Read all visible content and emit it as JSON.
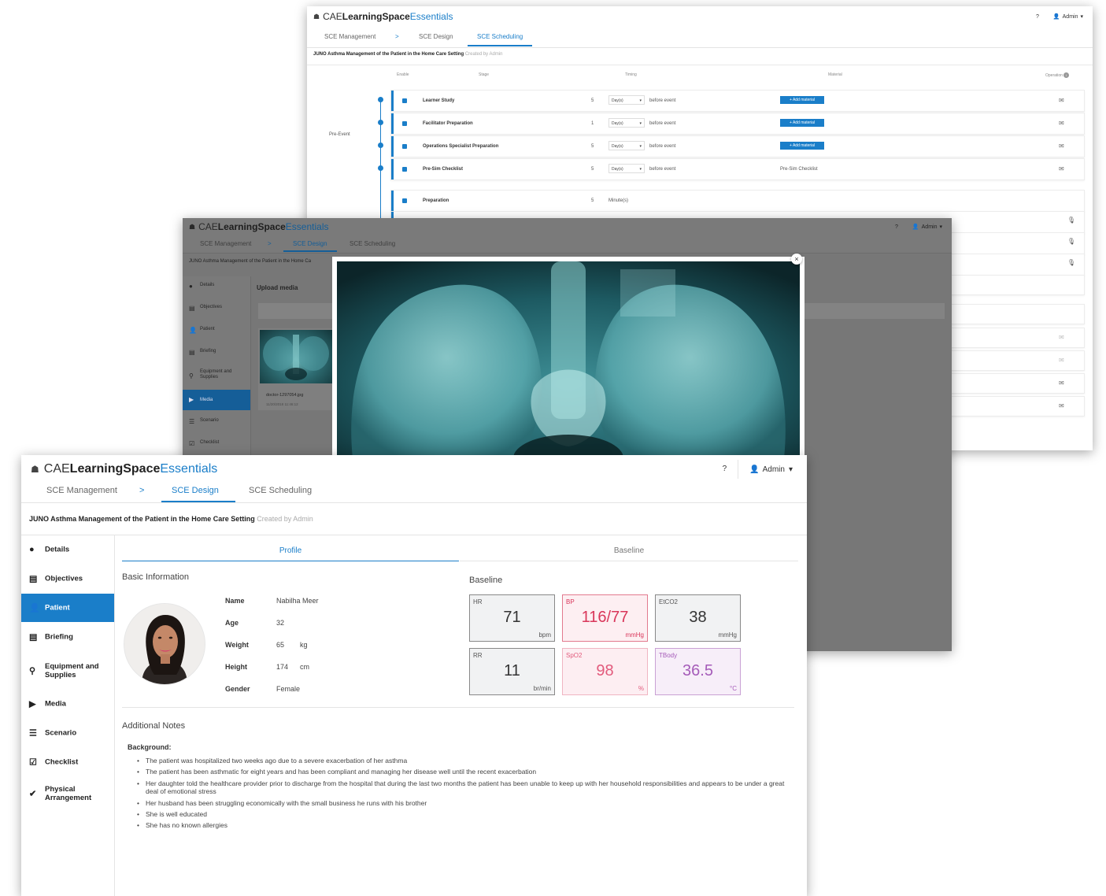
{
  "brand": {
    "home_icon": "☗",
    "cae": "CAE",
    "learning": "LearningSpace",
    "essentials": "Essentials"
  },
  "header": {
    "help": "?",
    "user": "Admin",
    "user_icon": "person-icon",
    "caret": "▾"
  },
  "nav_tabs": {
    "management": "SCE Management",
    "arrow": ">",
    "design": "SCE Design",
    "scheduling": "SCE Scheduling"
  },
  "sce_title": "JUNO Asthma Management of the Patient in the Home Care Setting",
  "sce_title_short": "JUNO Asthma Management of the Patient in the Home Ca",
  "created_by": "Created by Admin",
  "scheduling": {
    "columns": {
      "enable": "Enable",
      "stage": "Stage",
      "timing": "Timing",
      "material": "Material",
      "operation": "Operation"
    },
    "phase_label": "Pre-Event",
    "rows": [
      {
        "stage": "Learner Study",
        "num": "5",
        "unit": "Day(s)",
        "when": "before event",
        "material": "+ Add material"
      },
      {
        "stage": "Facilitator Preparation",
        "num": "1",
        "unit": "Day(s)",
        "when": "before event",
        "material": "+ Add material"
      },
      {
        "stage": "Operations Specialist Preparation",
        "num": "5",
        "unit": "Day(s)",
        "when": "before event",
        "material": "+ Add material"
      },
      {
        "stage": "Pre-Sim Checklist",
        "num": "5",
        "unit": "Day(s)",
        "when": "before event",
        "material": "Pre-Sim Checklist"
      }
    ],
    "prep_row": {
      "stage": "Preparation",
      "num": "5",
      "unit": "Minute(s)"
    }
  },
  "media_window": {
    "sidebar": [
      "Details",
      "Objectives",
      "Patient",
      "Briefing",
      "Equipment and Supplies",
      "Media",
      "Scenario",
      "Checklist"
    ],
    "upload_title": "Upload media",
    "file_name": "doctor-1297054.jpg",
    "file_date": "11/20/2018 11:46:12",
    "close": "×"
  },
  "patient_window": {
    "sidebar": [
      "Details",
      "Objectives",
      "Patient",
      "Briefing",
      "Equipment and Supplies",
      "Media",
      "Scenario",
      "Checklist",
      "Physical Arrangement"
    ],
    "tabs": {
      "profile": "Profile",
      "baseline": "Baseline"
    },
    "basic_info_title": "Basic Information",
    "fields": [
      {
        "label": "Name",
        "value": "Nabilha Meer",
        "unit": ""
      },
      {
        "label": "Age",
        "value": "32",
        "unit": ""
      },
      {
        "label": "Weight",
        "value": "65",
        "unit": "kg"
      },
      {
        "label": "Height",
        "value": "174",
        "unit": "cm"
      },
      {
        "label": "Gender",
        "value": "Female",
        "unit": ""
      }
    ],
    "baseline_title": "Baseline",
    "vitals": [
      {
        "label": "HR",
        "value": "71",
        "unit": "bpm"
      },
      {
        "label": "BP",
        "value": "116/77",
        "unit": "mmHg"
      },
      {
        "label": "EtCO2",
        "value": "38",
        "unit": "mmHg"
      },
      {
        "label": "RR",
        "value": "11",
        "unit": "br/min"
      },
      {
        "label": "SpO2",
        "value": "98",
        "unit": "%"
      },
      {
        "label": "TBody",
        "value": "36.5",
        "unit": "°C"
      }
    ],
    "notes_title": "Additional Notes",
    "background_label": "Background:",
    "notes": [
      "The patient was hospitalized two weeks ago due to a severe exacerbation of her asthma",
      "The patient has been asthmatic for eight years and has been compliant and managing her disease well until the recent exacerbation",
      "Her daughter told the healthcare provider prior to discharge from the hospital that during the last two months the patient has been unable to keep up with her household responsibilities and appears to be under a great deal of emotional stress",
      "Her husband has been struggling economically with the small business he runs with his brother",
      "She is well educated",
      "She has no known allergies"
    ]
  },
  "colors": {
    "accent": "#1a7ec9",
    "bp_red": "#d9365a",
    "spo2_pink": "#e25a7c",
    "tbody_purple": "#a55bb9"
  }
}
